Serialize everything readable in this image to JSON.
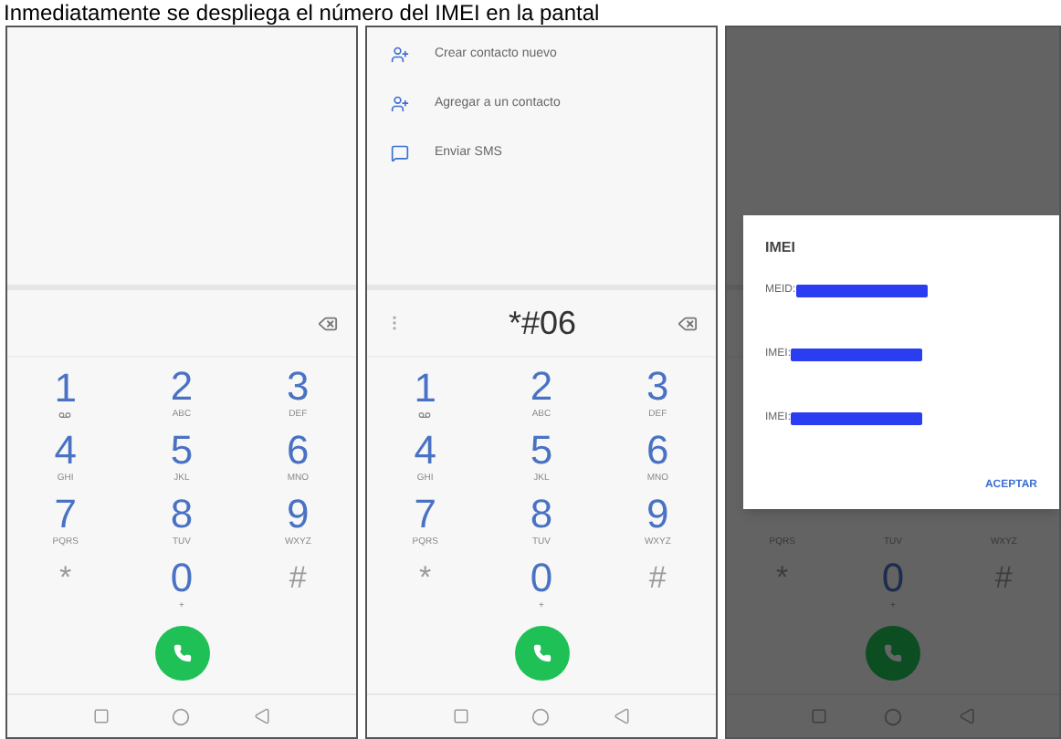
{
  "caption": "Inmediatamente se despliega el número del IMEI en la pantal",
  "screens": [
    {
      "dimmed": false,
      "overflow": false,
      "keys": [
        {
          "kind": "voicemail",
          "digit": "1"
        },
        {
          "kind": "digit",
          "digit": "2",
          "letters": "ABC"
        },
        {
          "kind": "digit",
          "digit": "3",
          "letters": "DEF"
        },
        {
          "kind": "digit",
          "digit": "4",
          "letters": "GHI"
        },
        {
          "kind": "digit",
          "digit": "5",
          "letters": "JKL"
        },
        {
          "kind": "digit",
          "digit": "6",
          "letters": "MNO"
        },
        {
          "kind": "digit",
          "digit": "7",
          "letters": "PQRS"
        },
        {
          "kind": "digit",
          "digit": "8",
          "letters": "TUV"
        },
        {
          "kind": "digit",
          "digit": "9",
          "letters": "WXYZ"
        },
        {
          "kind": "symbol",
          "digit": "*"
        },
        {
          "kind": "digit",
          "digit": "0",
          "letters": "+"
        },
        {
          "kind": "symbol",
          "digit": "#"
        }
      ]
    },
    {
      "dimmed": false,
      "number": "*#06",
      "overflow": true,
      "menu": [
        {
          "kind": "add-contact",
          "label": "Crear contacto nuevo"
        },
        {
          "kind": "add-contact",
          "label": "Agregar a un contacto"
        },
        {
          "kind": "message",
          "label": "Enviar SMS"
        }
      ],
      "keys": [
        {
          "kind": "voicemail",
          "digit": "1"
        },
        {
          "kind": "digit",
          "digit": "2",
          "letters": "ABC"
        },
        {
          "kind": "digit",
          "digit": "3",
          "letters": "DEF"
        },
        {
          "kind": "digit",
          "digit": "4",
          "letters": "GHI"
        },
        {
          "kind": "digit",
          "digit": "5",
          "letters": "JKL"
        },
        {
          "kind": "digit",
          "digit": "6",
          "letters": "MNO"
        },
        {
          "kind": "digit",
          "digit": "7",
          "letters": "PQRS"
        },
        {
          "kind": "digit",
          "digit": "8",
          "letters": "TUV"
        },
        {
          "kind": "digit",
          "digit": "9",
          "letters": "WXYZ"
        },
        {
          "kind": "symbol",
          "digit": "*"
        },
        {
          "kind": "digit",
          "digit": "0",
          "letters": "+"
        },
        {
          "kind": "symbol",
          "digit": "#"
        }
      ]
    },
    {
      "dimmed": true,
      "keys": [
        {
          "kind": "digit",
          "letters": "PQRS"
        },
        {
          "kind": "digit",
          "letters": "TUV"
        },
        {
          "kind": "digit",
          "letters": "WXYZ"
        },
        {
          "kind": "symbol",
          "digit": "*"
        },
        {
          "kind": "digit",
          "digit": "0",
          "letters": "+"
        },
        {
          "kind": "symbol",
          "digit": "#"
        }
      ],
      "dialog": {
        "title": "IMEI",
        "lines": [
          "MEID:",
          "IMEI:",
          "IMEI:"
        ],
        "button": "ACEPTAR"
      }
    }
  ]
}
